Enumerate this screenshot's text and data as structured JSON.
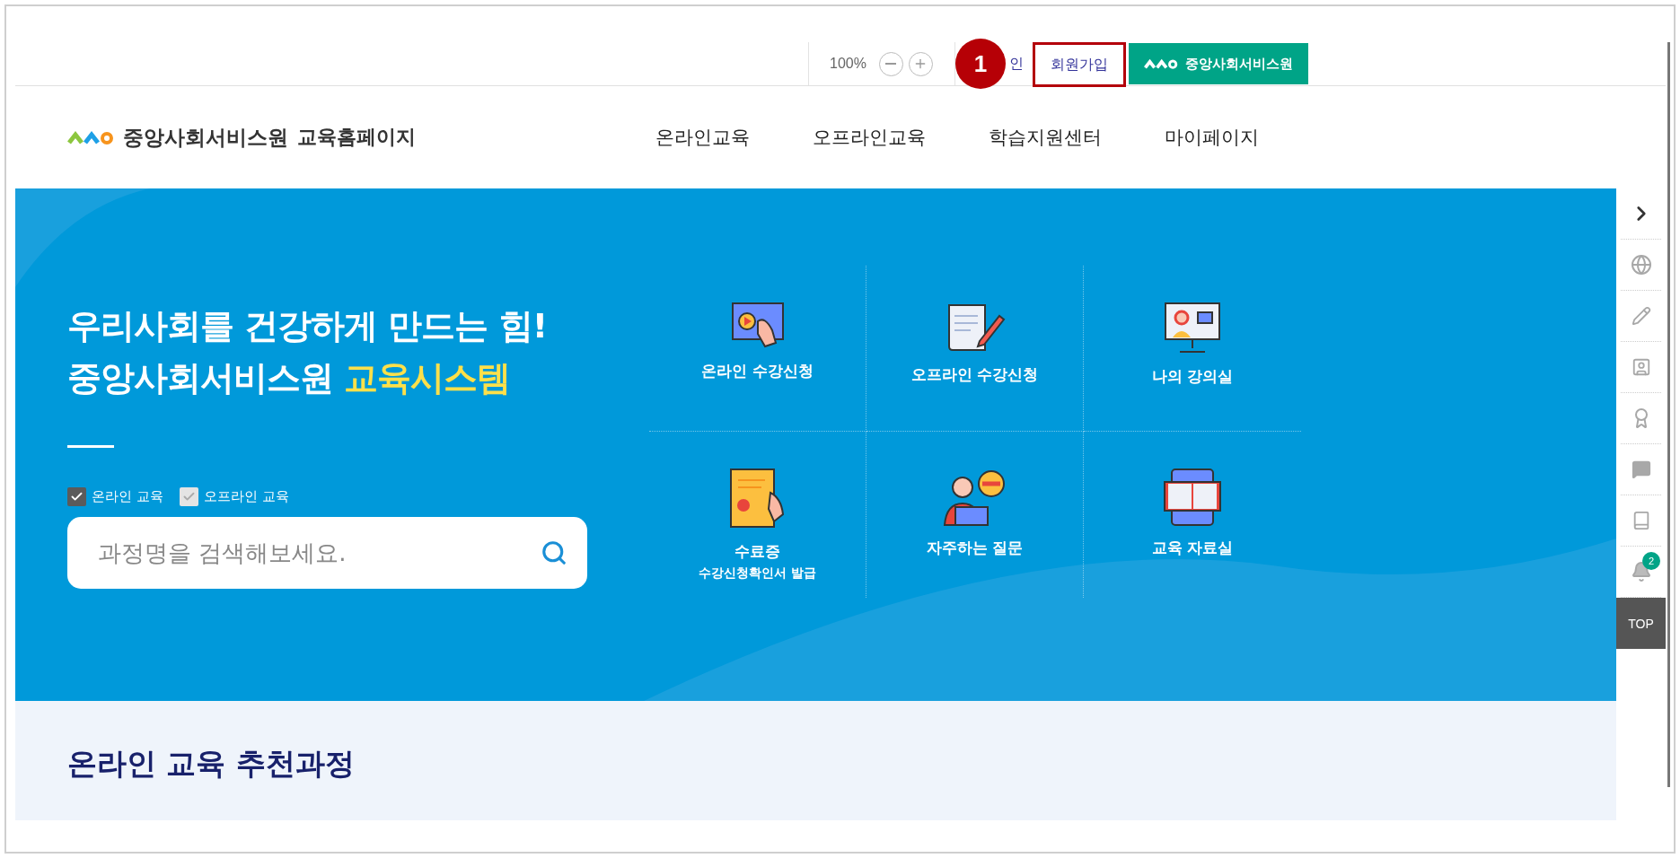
{
  "top_bar": {
    "zoom": "100%",
    "login_partial": "인",
    "signup": "회원가입",
    "org_button": "중앙사회서비스원"
  },
  "annotation": {
    "number": "1"
  },
  "header": {
    "logo_name": "중앙사회서비스원",
    "logo_sub": "교육홈페이지",
    "nav": [
      "온라인교육",
      "오프라인교육",
      "학습지원센터",
      "마이페이지"
    ]
  },
  "hero": {
    "headline_1": "우리사회를 건강하게 만드는 힘!",
    "headline_2": "중앙사회서비스원",
    "headline_2_highlight": "교육시스템",
    "filters": [
      {
        "label": "온라인 교육",
        "checked": true
      },
      {
        "label": "오프라인 교육",
        "checked": false
      }
    ],
    "search": {
      "placeholder": "과정명을 검색해보세요."
    },
    "shortcuts": [
      {
        "kind": "online",
        "label": "온라인 수강신청"
      },
      {
        "kind": "offline",
        "label": "오프라인 수강신청"
      },
      {
        "kind": "classroom",
        "label": "나의 강의실"
      },
      {
        "kind": "certificate",
        "label": "수료증",
        "sublabel": "수강신청확인서 발급"
      },
      {
        "kind": "faq",
        "label": "자주하는 질문"
      },
      {
        "kind": "library",
        "label": "교육 자료실"
      }
    ]
  },
  "side_panel": {
    "notification_count": "2",
    "top": "TOP"
  },
  "section": {
    "title": "온라인 교육 추천과정"
  }
}
